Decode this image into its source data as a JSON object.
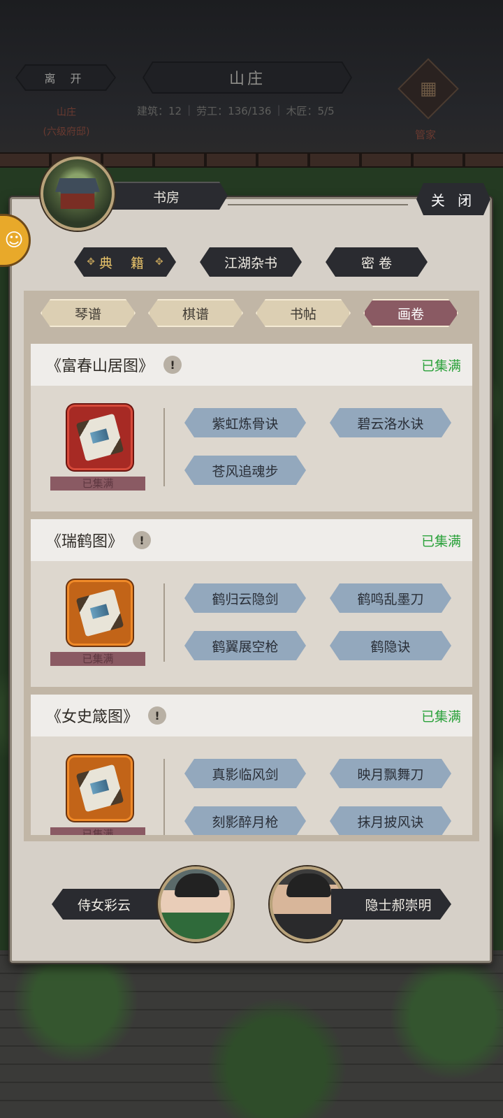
{
  "header": {
    "leave_label": "离 开",
    "title": "山庄",
    "location_name": "山庄",
    "location_rank": "(六级府邸)",
    "stats": {
      "building": "建筑：12",
      "labor": "劳工：136/136",
      "carpenter": "木匠：5/5"
    },
    "steward_label": "管家"
  },
  "panel": {
    "room_title": "书房",
    "close_label": "关 闭",
    "side_tab_glyph": "☺",
    "categories": [
      {
        "label": "典 籍",
        "active": true
      },
      {
        "label": "江湖杂书",
        "active": false
      },
      {
        "label": "密 卷",
        "active": false
      }
    ],
    "subtabs": [
      {
        "label": "琴谱",
        "active": false
      },
      {
        "label": "棋谱",
        "active": false
      },
      {
        "label": "书帖",
        "active": false
      },
      {
        "label": "画卷",
        "active": true
      }
    ],
    "collections": [
      {
        "title": "《富春山居图》",
        "info": "!",
        "status": "已集满",
        "item_label": "已集满",
        "frame": "red",
        "skills": [
          "紫虹炼骨诀",
          "碧云洛水诀",
          "苍风追魂步"
        ]
      },
      {
        "title": "《瑞鹤图》",
        "info": "!",
        "status": "已集满",
        "item_label": "已集满",
        "frame": "orange",
        "skills": [
          "鹤归云隐剑",
          "鹤鸣乱墨刀",
          "鹤翼展空枪",
          "鹤隐诀"
        ]
      },
      {
        "title": "《女史箴图》",
        "info": "!",
        "status": "已集满",
        "item_label": "已集满",
        "frame": "orange",
        "skills": [
          "真影临风剑",
          "映月飘舞刀",
          "刻影醉月枪",
          "抹月披风诀"
        ]
      }
    ]
  },
  "characters": {
    "left_name": "侍女彩云",
    "right_name": "隐士郝崇明"
  },
  "colors": {
    "status_green": "#2aa13a",
    "skill_blue": "#93a8bd",
    "active_subtab": "#8a5a63"
  }
}
